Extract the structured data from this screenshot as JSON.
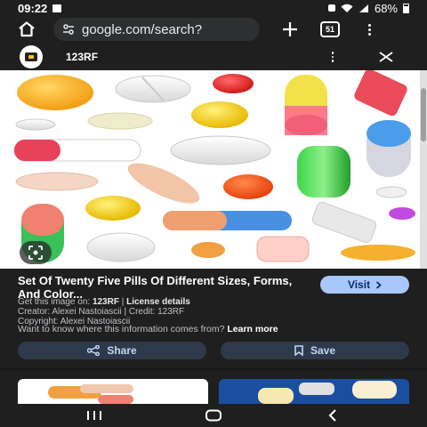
{
  "status_bar": {
    "time": "09:22",
    "battery": "68%",
    "icons": [
      "image-icon",
      "lock-icon",
      "wifi-icon",
      "signal-icon",
      "battery-icon"
    ]
  },
  "browser": {
    "url": "google.com/search?",
    "tab_count": "51",
    "icons": [
      "home-icon",
      "tune-icon",
      "plus-icon",
      "tabs-icon",
      "more-vert-icon"
    ]
  },
  "source": {
    "name": "123RF"
  },
  "result": {
    "title": "Set Of Twenty Five Pills Of Different Sizes, Forms, And Color...",
    "visit_label": "Visit",
    "get_image_on_prefix": "Get this image on: ",
    "get_image_on_source": "123RF",
    "separator": " | ",
    "license_details": "License details",
    "creator_line": "Creator: Alexei Nastoiascii | Credit: 123RF",
    "copyright_line": "Copyright: Alexei Nastoiascii",
    "info_question": "Want to know where this information comes from?",
    "learn_more": "Learn more"
  },
  "actions": {
    "share_label": "Share",
    "save_label": "Save"
  },
  "colors": {
    "background": "#1f1f1f",
    "visit_button": "#a8c7fa",
    "action_button": "#2e3a4a",
    "action_text": "#c2d6f5"
  }
}
